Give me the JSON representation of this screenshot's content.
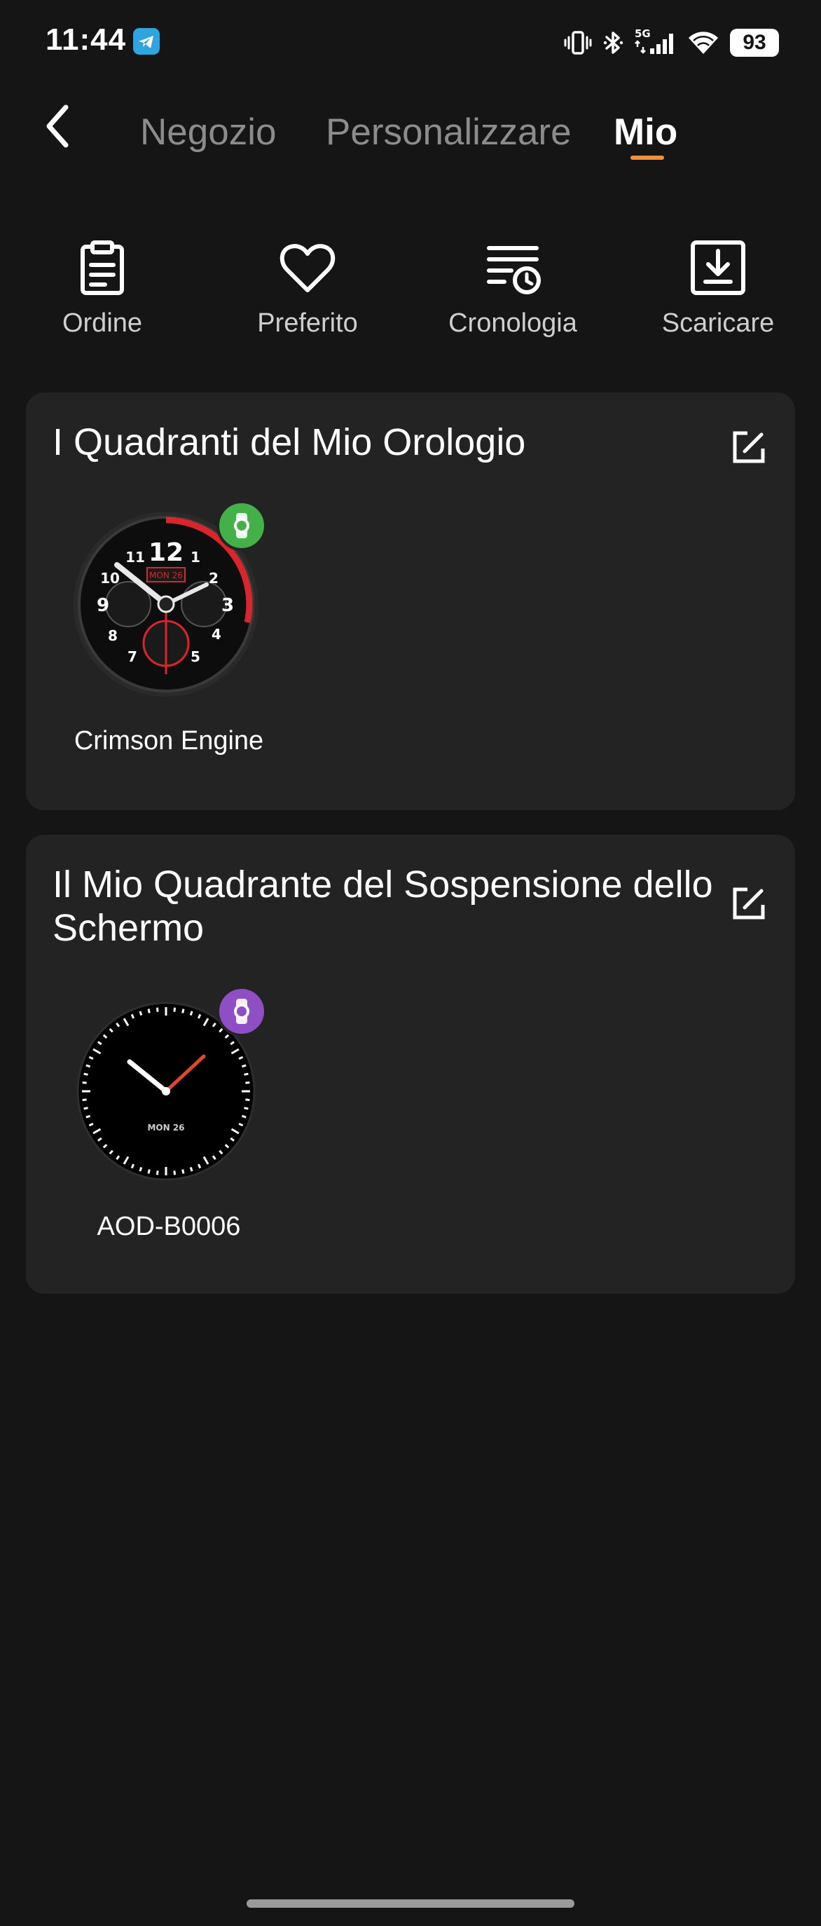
{
  "status_bar": {
    "time": "11:44",
    "left_icons": [
      "telegram-icon"
    ],
    "right_icons": [
      "vibrate-icon",
      "bluetooth-icon",
      "signal-5g-icon",
      "wifi-icon"
    ],
    "network_label": "5G",
    "battery": "93"
  },
  "header": {
    "back_icon": "chevron-left-icon",
    "tabs": [
      {
        "label": "Negozio",
        "active": false
      },
      {
        "label": "Personalizzare",
        "active": false
      },
      {
        "label": "Mio",
        "active": true
      }
    ],
    "accent_color": "#f0913a"
  },
  "shortcuts": [
    {
      "label": "Ordine",
      "icon": "clipboard-icon"
    },
    {
      "label": "Preferito",
      "icon": "heart-icon"
    },
    {
      "label": "Cronologia",
      "icon": "history-icon"
    },
    {
      "label": "Scaricare",
      "icon": "download-icon"
    }
  ],
  "sections": [
    {
      "title": "I Quadranti del Mio Orologio",
      "edit_icon": "edit-icon",
      "items": [
        {
          "name": "Crimson Engine",
          "badge_icon": "watch-icon",
          "badge_color": "#43b04a",
          "face": {
            "numerals": [
              "12",
              "1",
              "2",
              "3",
              "4",
              "5",
              "7",
              "8",
              "9",
              "10",
              "11"
            ],
            "date": "MON 26",
            "accent": "#d9252c"
          }
        }
      ]
    },
    {
      "title": "Il Mio Quadrante del Sospensione dello Schermo",
      "edit_icon": "edit-icon",
      "items": [
        {
          "name": "AOD-B0006",
          "badge_icon": "watch-icon",
          "badge_color": "#8e4fc4",
          "face": {
            "date": "MON 26",
            "accent": "#e0472b"
          }
        }
      ]
    }
  ],
  "colors": {
    "background": "#151515",
    "card": "#232323",
    "inactive_tab": "#8c8c8c"
  }
}
